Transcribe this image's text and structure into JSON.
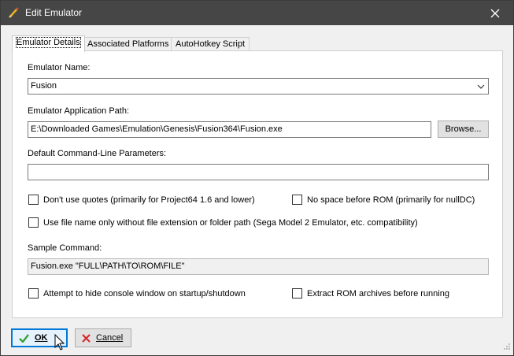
{
  "window": {
    "title": "Edit Emulator",
    "app_icon": "pencil-icon",
    "close_icon": "close-icon"
  },
  "tabs": [
    {
      "label": "Emulator Details",
      "active": true
    },
    {
      "label": "Associated Platforms",
      "active": false
    },
    {
      "label": "AutoHotkey Script",
      "active": false
    }
  ],
  "form": {
    "emulator_name_label": "Emulator Name:",
    "emulator_name_value": "Fusion",
    "app_path_label": "Emulator Application Path:",
    "app_path_value": "E:\\Downloaded Games\\Emulation\\Genesis\\Fusion364\\Fusion.exe",
    "browse_label": "Browse...",
    "params_label": "Default Command-Line Parameters:",
    "params_value": "",
    "no_quotes_label": "Don't use quotes (primarily for Project64 1.6 and lower)",
    "no_space_label": "No space before ROM (primarily for nullDC)",
    "filename_only_label": "Use file name only without file extension or folder path (Sega Model 2 Emulator, etc. compatibility)",
    "sample_label": "Sample Command:",
    "sample_value": "Fusion.exe \"FULL\\PATH\\TO\\ROM\\FILE\"",
    "hide_console_label": "Attempt to hide console window on startup/shutdown",
    "extract_rom_label": "Extract ROM archives before running"
  },
  "footer": {
    "ok_label": "OK",
    "cancel_label": "Cancel"
  },
  "colors": {
    "titlebar": "#464646",
    "accent": "#0078d7",
    "ok_check": "#3aa13a",
    "cancel_x": "#d42b2b"
  }
}
